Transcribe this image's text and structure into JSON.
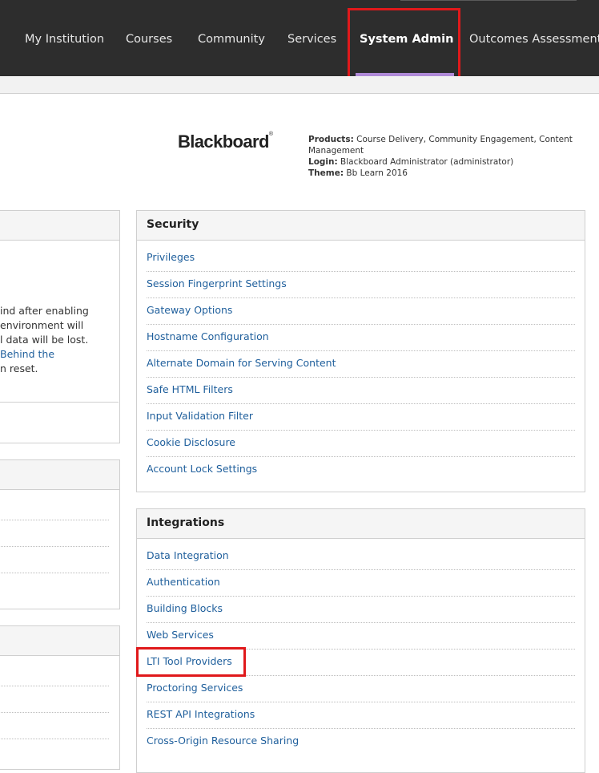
{
  "nav": {
    "tabs": [
      {
        "label": "My Institution"
      },
      {
        "label": "Courses"
      },
      {
        "label": "Community"
      },
      {
        "label": "Services"
      },
      {
        "label": "System Admin"
      },
      {
        "label": "Outcomes Assessment"
      }
    ],
    "active_tab": "System Admin",
    "highlight_color": "#e0191b",
    "active_underline_color": "#b08ad8"
  },
  "header": {
    "logo_text": "Blackboard",
    "logo_mark": "®",
    "products_label": "Products:",
    "products_value": "Course Delivery, Community Engagement, Content Management",
    "login_label": "Login:",
    "login_value": "Blackboard Administrator (administrator)",
    "theme_label": "Theme:",
    "theme_value": "Bb Learn 2016"
  },
  "left_panel": {
    "text_lines": [
      "ind after enabling",
      "environment will",
      "l data will be lost.",
      "Behind the",
      "n reset."
    ]
  },
  "security": {
    "title": "Security",
    "links": [
      "Privileges",
      "Session Fingerprint Settings",
      "Gateway Options",
      "Hostname Configuration",
      "Alternate Domain for Serving Content",
      "Safe HTML Filters",
      "Input Validation Filter",
      "Cookie Disclosure",
      "Account Lock Settings"
    ]
  },
  "integrations": {
    "title": "Integrations",
    "links": [
      "Data Integration",
      "Authentication",
      "Building Blocks",
      "Web Services",
      "LTI Tool Providers",
      "Proctoring Services",
      "REST API Integrations",
      "Cross-Origin Resource Sharing"
    ],
    "highlighted_link": "LTI Tool Providers"
  },
  "colors": {
    "nav_bg": "#2d2d2d",
    "link": "#1f5f9c"
  }
}
